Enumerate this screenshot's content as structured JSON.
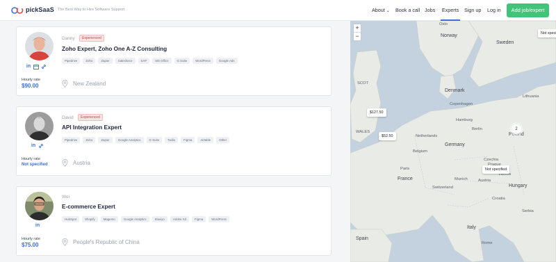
{
  "header": {
    "logo_text": "pickSaaS",
    "tagline": "The Best Way to Hire Software Support",
    "nav": [
      "About",
      "Book a call",
      "Jobs",
      "Experts",
      "Sign up",
      "Log in"
    ],
    "about_chevron": "⌄",
    "cta_label": "Add job/expert"
  },
  "experts": [
    {
      "first_name": "Danny",
      "badge": "Experienced",
      "title": "Zoho Expert, Zoho One A-Z Consulting",
      "tags": [
        "Pipedrive",
        "Zoho",
        "Zapier",
        "Salesforce",
        "SAP",
        "MS Office",
        "G Suite",
        "WordPress",
        "Google Ads"
      ],
      "rate_label": "Hourly rate",
      "rate": "$90.00",
      "location": "New Zealand",
      "social": [
        "linkedin-icon",
        "calendar-icon",
        "link-icon"
      ]
    },
    {
      "first_name": "David",
      "badge": "Experienced",
      "title": "API Integration Expert",
      "tags": [
        "Pipedrive",
        "Zoho",
        "Zapier",
        "Google Analytics",
        "G Suite",
        "Twilio",
        "Figma",
        "Airtable",
        "Other"
      ],
      "rate_label": "Hourly rate",
      "rate": "Not specified",
      "location": "Austria",
      "social": [
        "linkedin-icon",
        "link-icon"
      ]
    },
    {
      "first_name": "Wei",
      "badge": "",
      "title": "E-commerce Expert",
      "tags": [
        "HubSpot",
        "Shopify",
        "Magento",
        "Google Analytics",
        "Klaviyo",
        "Adobe Xd",
        "Figma",
        "WordPress"
      ],
      "rate_label": "Hourly rate",
      "rate": "$75.00",
      "location": "People's Republic of China",
      "social": [
        "linkedin-icon"
      ]
    }
  ],
  "map": {
    "zoom_in": "+",
    "zoom_out": "−",
    "markers": [
      "$127.50",
      "$52.50",
      "Not specified",
      "Not specified"
    ],
    "cluster_count": "2",
    "labels": {
      "norway": "Norway",
      "sweden": "Sweden",
      "denmark": "Denmark",
      "netherlands": "Netherlands",
      "belgium": "Belgium",
      "germany": "Germany",
      "poland": "Poland",
      "czechia": "Czechia",
      "austria": "Austria",
      "hungary": "Hungary",
      "france": "France",
      "switzerland": "Switzerland",
      "italy": "Italy",
      "spain": "Spain",
      "croatia": "Croatia",
      "serbia": "Serbia",
      "lithuania": "Lithuania",
      "paris": "Paris",
      "berlin": "Berlin",
      "wales": "WALES",
      "scot": "SCOT",
      "oslo": "Oslo",
      "copenhagen": "Copenhagen",
      "hamburg": "Hamburg",
      "prague": "Prague",
      "vienna": "Vienna",
      "rome": "Rome",
      "munich": "Munich"
    }
  },
  "colors": {
    "accent": "#3b6fd8",
    "cta": "#41c47a",
    "badge_bg": "#fbe3e3",
    "badge_text": "#c24a4a",
    "map_water": "#c4d2df",
    "map_land": "#e9ebe6"
  }
}
